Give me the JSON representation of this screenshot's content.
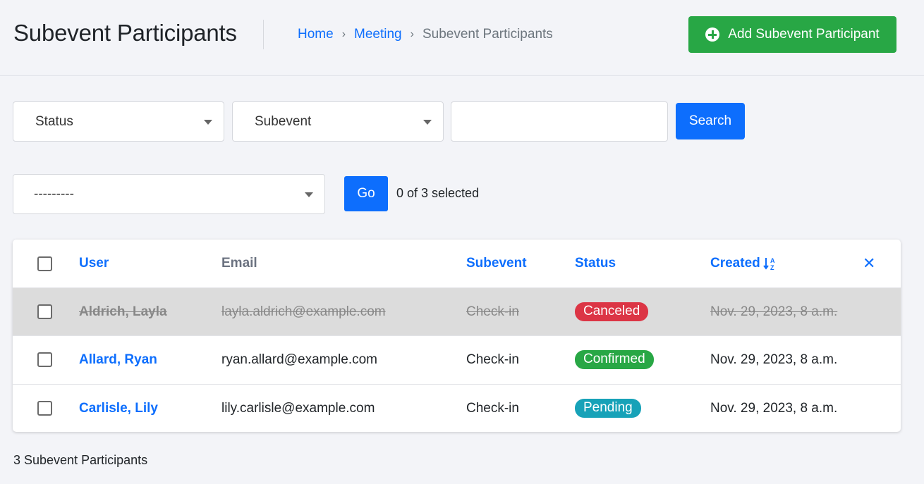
{
  "header": {
    "title": "Subevent Participants",
    "breadcrumb": [
      {
        "label": "Home"
      },
      {
        "label": "Meeting"
      },
      {
        "label": "Subevent Participants"
      }
    ],
    "add_button_label": "Add Subevent Participant"
  },
  "filters": {
    "status_label": "Status",
    "subevent_label": "Subevent",
    "search_value": "",
    "search_button": "Search"
  },
  "actions": {
    "action_select_value": "---------",
    "go_label": "Go",
    "selected_text": "0 of 3 selected"
  },
  "table": {
    "columns": {
      "user": "User",
      "email": "Email",
      "subevent": "Subevent",
      "status": "Status",
      "created": "Created"
    },
    "rows": [
      {
        "user": "Aldrich, Layla",
        "email": "layla.aldrich@example.com",
        "subevent": "Check-in",
        "status": "Canceled",
        "created": "Nov. 29, 2023, 8 a.m."
      },
      {
        "user": "Allard, Ryan",
        "email": "ryan.allard@example.com",
        "subevent": "Check-in",
        "status": "Confirmed",
        "created": "Nov. 29, 2023, 8 a.m."
      },
      {
        "user": "Carlisle, Lily",
        "email": "lily.carlisle@example.com",
        "subevent": "Check-in",
        "status": "Pending",
        "created": "Nov. 29, 2023, 8 a.m."
      }
    ]
  },
  "status_colors": {
    "Canceled": "#dc3545",
    "Confirmed": "#28a745",
    "Pending": "#17a2b8"
  },
  "footer": {
    "count_text": "3 Subevent Participants"
  }
}
